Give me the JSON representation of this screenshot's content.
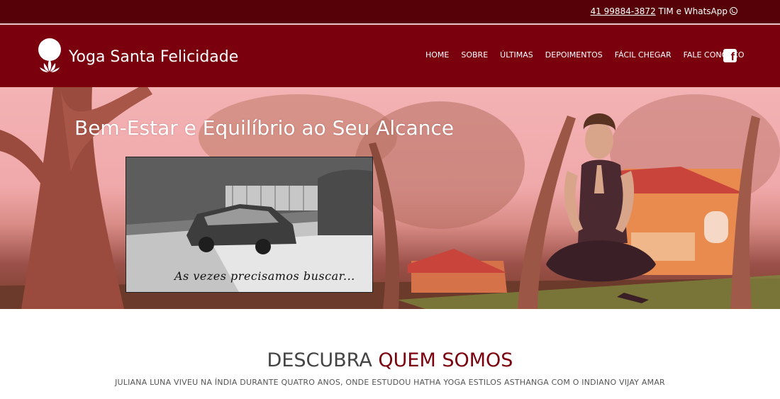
{
  "topbar": {
    "phone": "41 99884-3872",
    "carrier": " TIM e WhatsApp"
  },
  "header": {
    "brand": "Yoga Santa Felicidade",
    "nav": [
      "HOME",
      "SOBRE",
      "ÚLTIMAS",
      "DEPOIMENTOS",
      "FÁCIL CHEGAR",
      "FALE CONOSCO"
    ]
  },
  "hero": {
    "title": "Bem-Estar e Equilíbrio ao Seu Alcance",
    "video_caption": "As vezes precisamos buscar..."
  },
  "about": {
    "title_prefix": "DESCUBRA ",
    "title_accent": "QUEM SOMOS",
    "subtitle": "JULIANA LUNA VIVEU NA ÍNDIA DURANTE QUATRO ANOS, ONDE ESTUDOU HATHA YOGA ESTILOS ASTHANGA COM O INDIANO VIJAY AMAR"
  },
  "colors": {
    "topbar": "#560008",
    "navbar": "#7b000e",
    "accent": "#7b000e"
  },
  "icons": [
    "lotus-logo-icon",
    "whatsapp-icon",
    "facebook-icon",
    "play-video"
  ]
}
